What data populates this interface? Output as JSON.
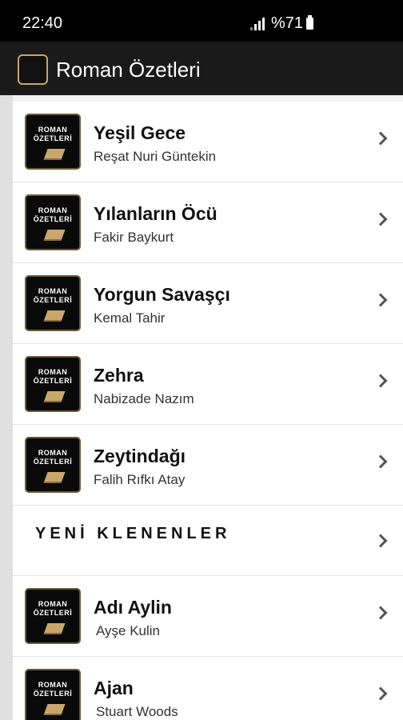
{
  "status_bar": {
    "time": "22:40",
    "battery": "%71"
  },
  "app_bar": {
    "title": "Roman Özetleri"
  },
  "thumbnail": {
    "line1": "ROMAN",
    "line2": "ÖZETLERİ"
  },
  "items_top": [
    {
      "title": "Yeşil Gece",
      "author": "Reşat Nuri Güntekin"
    },
    {
      "title": "Yılanların Öcü",
      "author": "Fakir Baykurt"
    },
    {
      "title": "Yorgun Savaşçı",
      "author": "Kemal Tahir"
    },
    {
      "title": "Zehra",
      "author": "Nabizade Nazım"
    },
    {
      "title": "Zeytindağı",
      "author": "Falih Rıfkı Atay"
    }
  ],
  "section": {
    "label": "YENİ KLENENLER"
  },
  "items_bottom": [
    {
      "title": "Adı Aylin",
      "author": "Ayşe Kulin"
    },
    {
      "title": "Ajan",
      "author": "Stuart Woods"
    }
  ]
}
